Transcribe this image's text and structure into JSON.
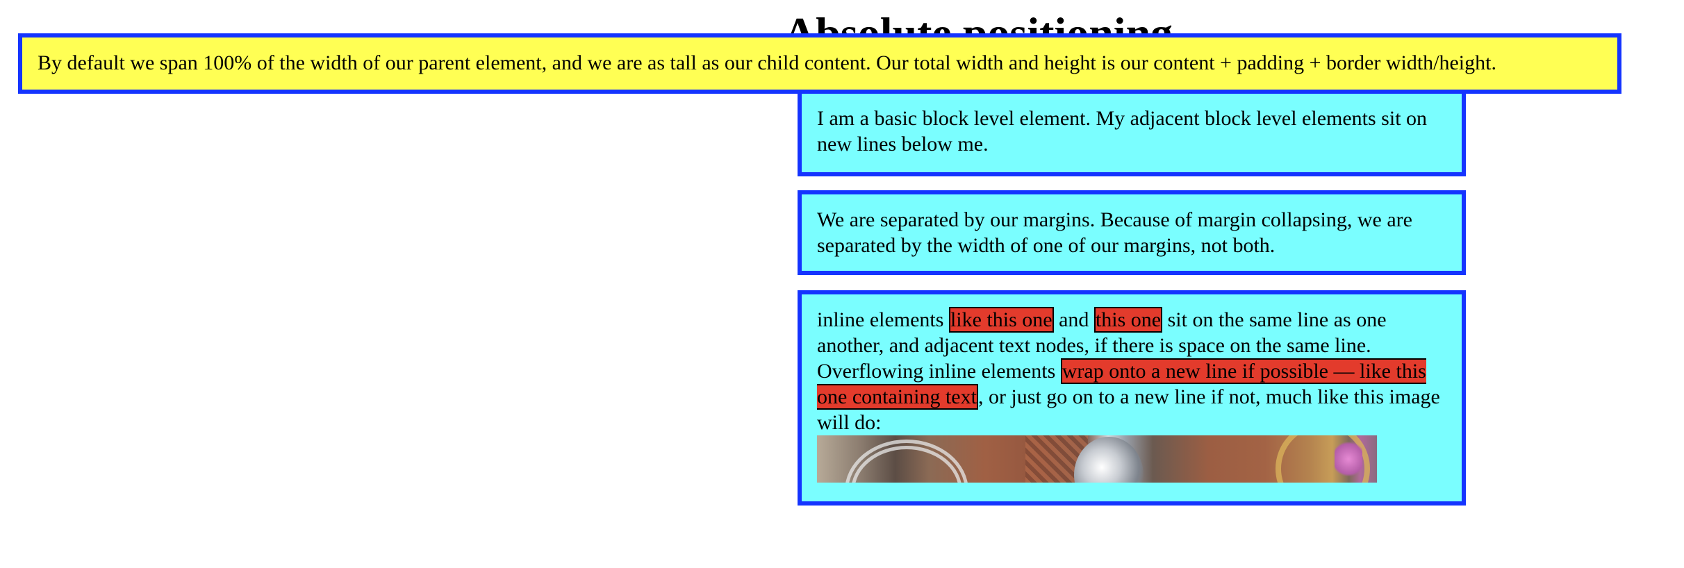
{
  "page": {
    "title": "Absolute positioning"
  },
  "absolute_box": {
    "text": "By default we span 100% of the width of our parent element, and we are as tall as our child content. Our total width and height is our content + padding + border width/height."
  },
  "block_1": {
    "text": "I am a basic block level element. My adjacent block level elements sit on new lines below me."
  },
  "block_2": {
    "text": "We are separated by our margins. Because of margin collapsing, we are separated by the width of one of our margins, not both."
  },
  "block_3": {
    "text_1": "inline elements ",
    "inline_1": "like this one",
    "text_2": " and ",
    "inline_2": "this one",
    "text_3": " sit on the same line as one another, and adjacent text nodes, if there is space on the same line. Overflowing inline elements ",
    "inline_3": "wrap onto a new line if possible — like this one containing text",
    "text_4": ", or just go on to a new line if not, much like this image will do:"
  },
  "colors": {
    "block_background": "#7afeff",
    "absolute_background": "#ffff54",
    "border": "#1434ff",
    "inline_background": "#e33b2c"
  }
}
